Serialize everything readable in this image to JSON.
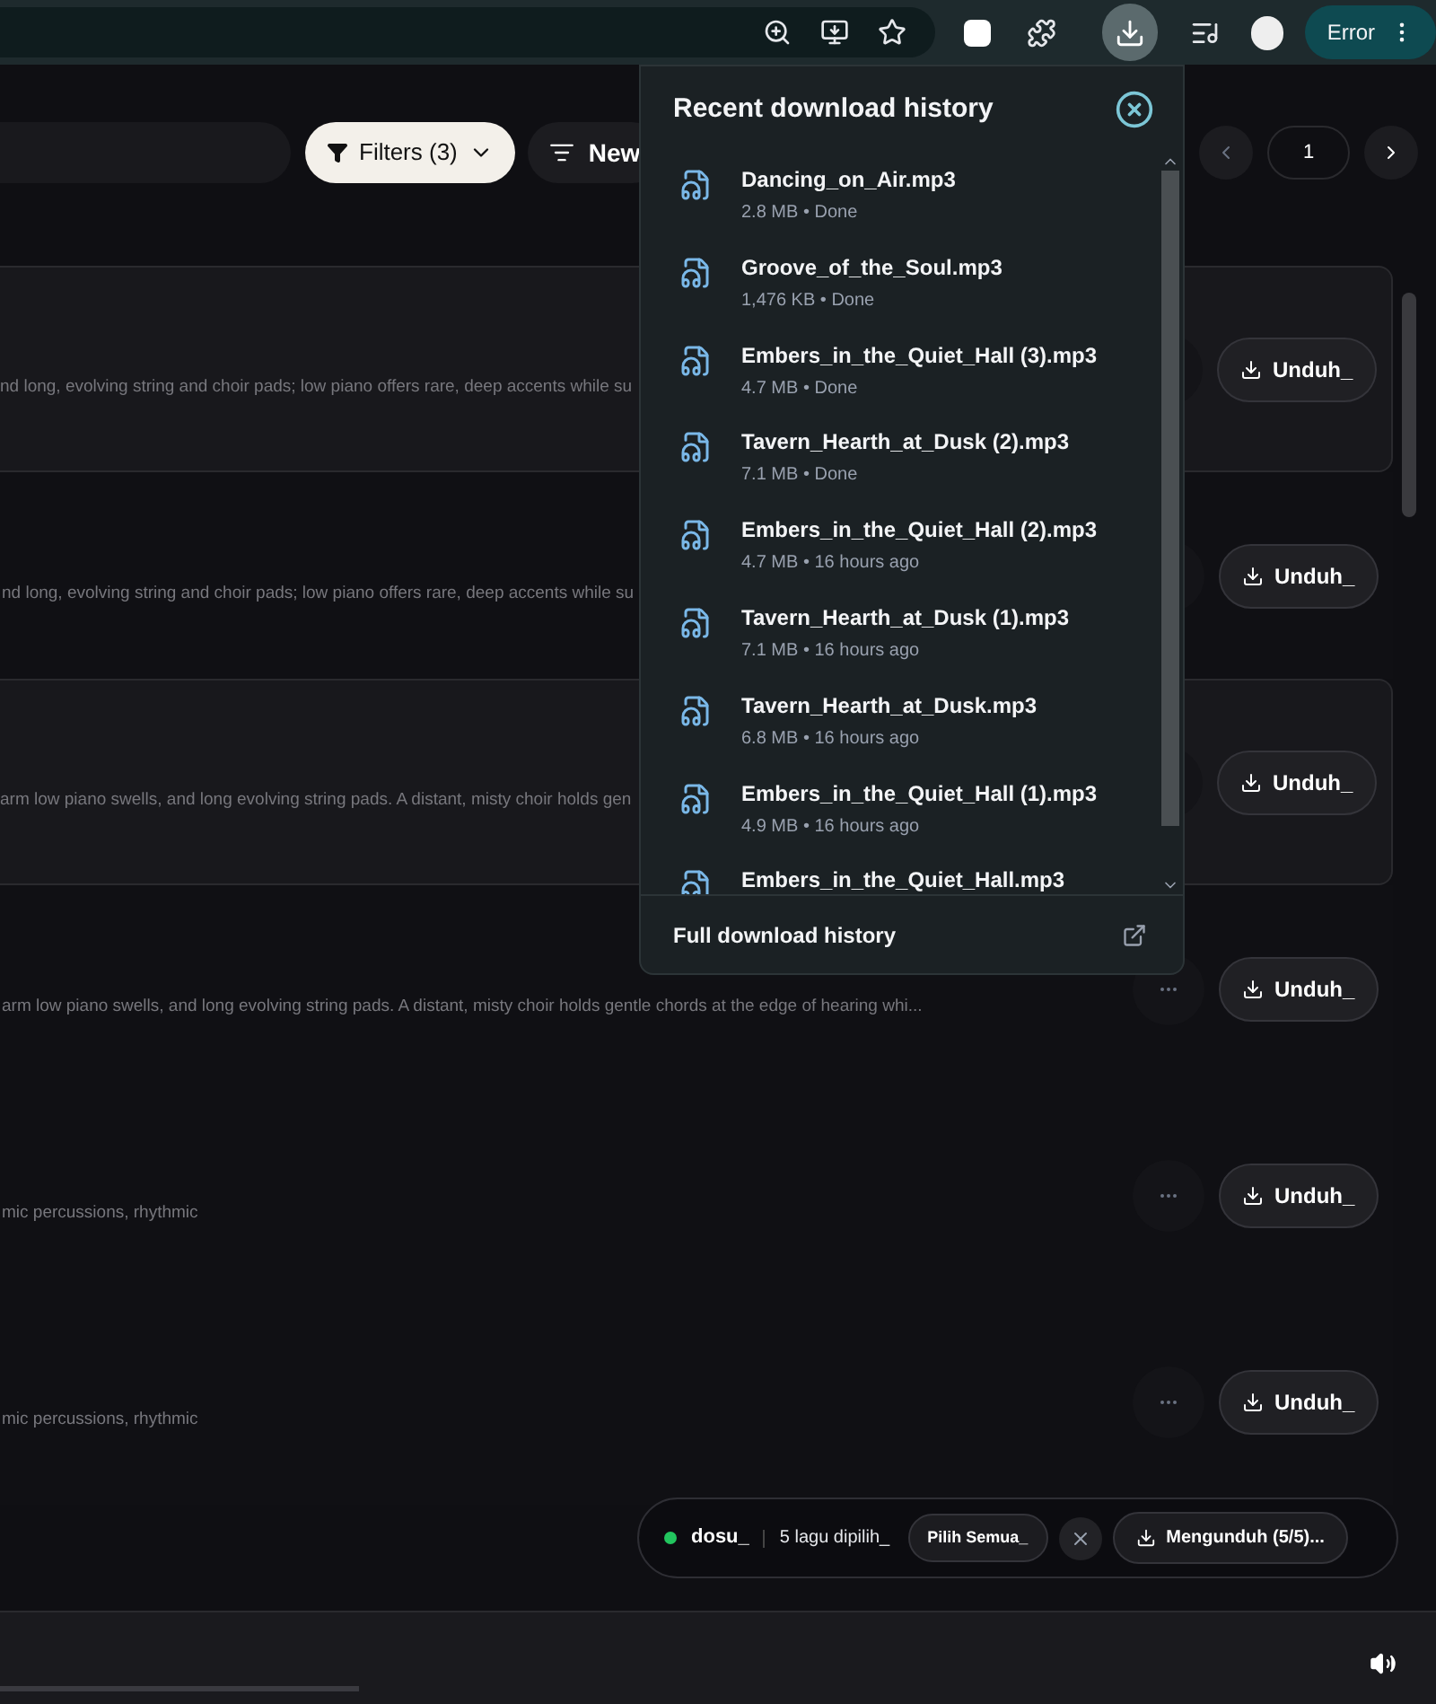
{
  "browser": {
    "profile_label": "Error"
  },
  "toolbar": {
    "filters_label": "Filters (3)",
    "sort_label": "New",
    "page": "1"
  },
  "songs": [
    {
      "description": "nd long, evolving string and choir pads; low piano offers rare, deep accents while su",
      "selected": true,
      "download_label": "Unduh_"
    },
    {
      "description": "nd long, evolving string and choir pads; low piano offers rare, deep accents while su",
      "selected": false,
      "download_label": "Unduh_"
    },
    {
      "description": "arm low piano swells, and long evolving string pads. A distant, misty choir holds gen",
      "selected": true,
      "download_label": "Unduh_"
    },
    {
      "description": "arm low piano swells, and long evolving string pads. A distant, misty choir holds gentle chords at the edge of hearing whi...",
      "selected": false,
      "download_label": "Unduh_"
    },
    {
      "description": "mic percussions, rhythmic",
      "selected": false,
      "download_label": "Unduh_"
    },
    {
      "description": "mic percussions, rhythmic",
      "selected": false,
      "download_label": "Unduh_"
    }
  ],
  "downloads_popup": {
    "title": "Recent download history",
    "items": [
      {
        "name": "Dancing_on_Air.mp3",
        "meta": "2.8 MB • Done"
      },
      {
        "name": "Groove_of_the_Soul.mp3",
        "meta": "1,476 KB • Done"
      },
      {
        "name": "Embers_in_the_Quiet_Hall (3).mp3",
        "meta": "4.7 MB • Done"
      },
      {
        "name": "Tavern_Hearth_at_Dusk (2).mp3",
        "meta": "7.1 MB • Done"
      },
      {
        "name": "Embers_in_the_Quiet_Hall (2).mp3",
        "meta": "4.7 MB • 16 hours ago"
      },
      {
        "name": "Tavern_Hearth_at_Dusk (1).mp3",
        "meta": "7.1 MB • 16 hours ago"
      },
      {
        "name": "Tavern_Hearth_at_Dusk.mp3",
        "meta": "6.8 MB • 16 hours ago"
      },
      {
        "name": "Embers_in_the_Quiet_Hall (1).mp3",
        "meta": "4.9 MB • 16 hours ago"
      },
      {
        "name": "Embers_in_the_Quiet_Hall.mp3"
      }
    ],
    "footer_link": "Full download history"
  },
  "selection_bar": {
    "online": true,
    "user": "dosu_",
    "count": "5 lagu dipilih_",
    "select_all": "Pilih Semua_",
    "download_label": "Mengunduh (5/5)..."
  },
  "player": {
    "level": 0.25
  }
}
